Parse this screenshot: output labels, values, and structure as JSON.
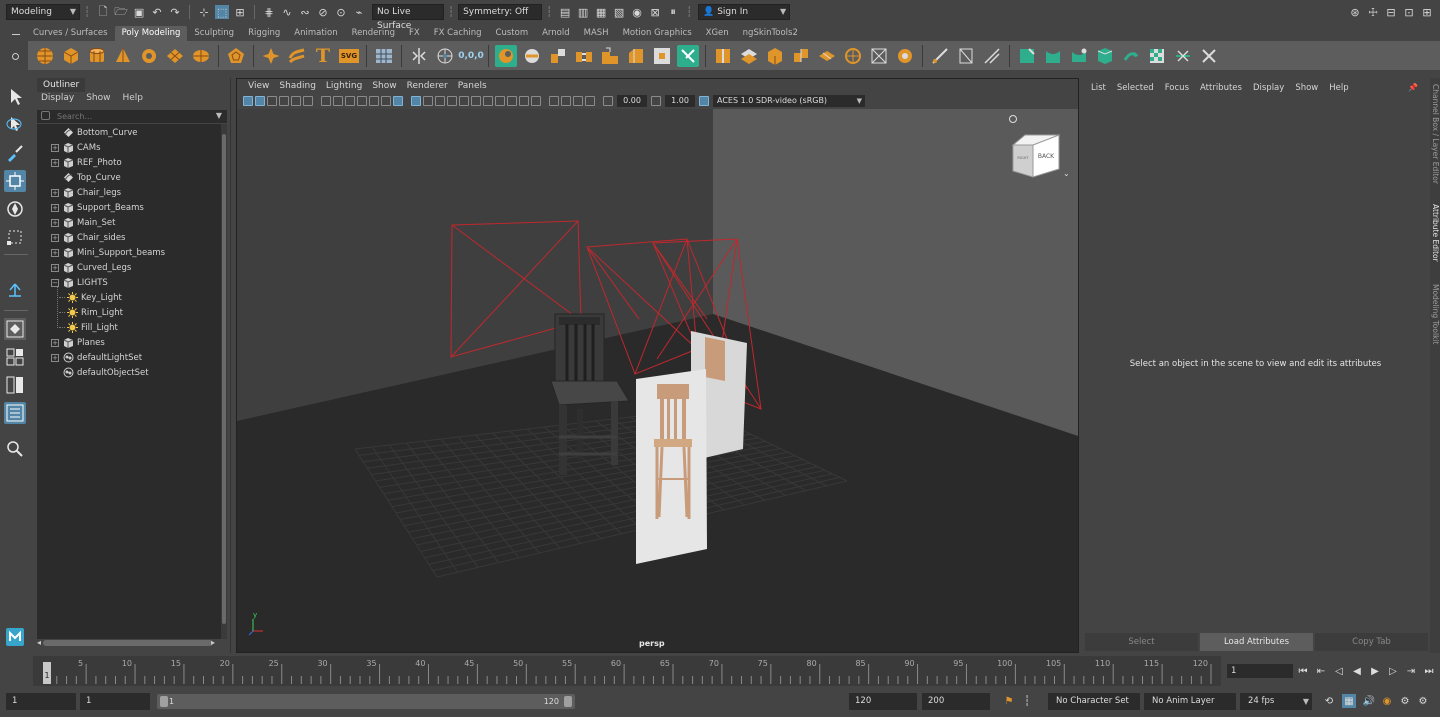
{
  "status_line": {
    "menu_set": "Modeling",
    "live_surface": "No Live Surface",
    "symmetry": "Symmetry: Off",
    "sign_in": "Sign In"
  },
  "shelf": {
    "tabs": [
      "Curves / Surfaces",
      "Poly Modeling",
      "Sculpting",
      "Rigging",
      "Animation",
      "Rendering",
      "FX",
      "FX Caching",
      "Custom",
      "Arnold",
      "MASH",
      "Motion Graphics",
      "XGen",
      "ngSkinTools2"
    ],
    "active_tab": "Poly Modeling",
    "text_tool_label": "T",
    "svg_tool_label": "SVG"
  },
  "outliner": {
    "title": "Outliner",
    "menu": [
      "Display",
      "Show",
      "Help"
    ],
    "search_placeholder": "Search...",
    "items": [
      {
        "label": "Bottom_Curve",
        "icon": "curve-icon",
        "expandable": false,
        "depth": 0
      },
      {
        "label": "CAMs",
        "icon": "group-icon",
        "expandable": true,
        "depth": 0
      },
      {
        "label": "REF_Photo",
        "icon": "group-icon",
        "expandable": true,
        "depth": 0
      },
      {
        "label": "Top_Curve",
        "icon": "curve-icon",
        "expandable": false,
        "depth": 0
      },
      {
        "label": "Chair_legs",
        "icon": "group-icon",
        "expandable": true,
        "depth": 0
      },
      {
        "label": "Support_Beams",
        "icon": "group-icon",
        "expandable": true,
        "depth": 0
      },
      {
        "label": "Main_Set",
        "icon": "group-icon",
        "expandable": true,
        "depth": 0
      },
      {
        "label": "Chair_sides",
        "icon": "group-icon",
        "expandable": true,
        "depth": 0
      },
      {
        "label": "Mini_Support_beams",
        "icon": "group-icon",
        "expandable": true,
        "depth": 0
      },
      {
        "label": "Curved_Legs",
        "icon": "group-icon",
        "expandable": true,
        "depth": 0
      },
      {
        "label": "LIGHTS",
        "icon": "group-icon",
        "expandable": true,
        "expanded": true,
        "depth": 0
      },
      {
        "label": "Key_Light",
        "icon": "light-icon",
        "expandable": false,
        "depth": 1
      },
      {
        "label": "Rim_Light",
        "icon": "light-icon",
        "expandable": false,
        "depth": 1
      },
      {
        "label": "Fill_Light",
        "icon": "light-icon",
        "expandable": false,
        "depth": 1
      },
      {
        "label": "Planes",
        "icon": "group-icon",
        "expandable": true,
        "depth": 0
      },
      {
        "label": "defaultLightSet",
        "icon": "set-icon",
        "expandable": true,
        "depth": 0
      },
      {
        "label": "defaultObjectSet",
        "icon": "set-icon",
        "expandable": false,
        "depth": 0
      }
    ]
  },
  "viewport": {
    "menu": [
      "View",
      "Shading",
      "Lighting",
      "Show",
      "Renderer",
      "Panels"
    ],
    "exposure": "0.00",
    "gamma": "1.00",
    "color_space": "ACES 1.0 SDR-video (sRGB)",
    "camera": "persp",
    "view_cube_face": "BACK",
    "view_cube_side": "RIGHT"
  },
  "attribute_editor": {
    "menu": [
      "List",
      "Selected",
      "Focus",
      "Attributes",
      "Display",
      "Show",
      "Help"
    ],
    "message": "Select an object in the scene to view and edit its attributes",
    "buttons": [
      {
        "label": "Select",
        "enabled": false
      },
      {
        "label": "Load Attributes",
        "enabled": true
      },
      {
        "label": "Copy Tab",
        "enabled": false
      }
    ],
    "side_tabs": [
      "Channel Box / Layer Editor",
      "Attribute Editor",
      "Modeling Toolkit"
    ]
  },
  "time_slider": {
    "ticks": [
      1,
      5,
      10,
      15,
      20,
      25,
      30,
      35,
      40,
      45,
      50,
      55,
      60,
      65,
      70,
      75,
      80,
      85,
      90,
      95,
      100,
      105,
      110,
      115,
      120
    ],
    "max": 120,
    "current_frame": "1"
  },
  "range_slider": {
    "start_frame": "1",
    "playback_start": "1",
    "range_start": "1",
    "range_end": "120",
    "playback_end": "120",
    "end_frame": "200",
    "character_set": "No Character Set",
    "anim_layer": "No Anim Layer",
    "fps": "24 fps"
  },
  "colors": {
    "accent": "#5285a6",
    "panel": "#444444",
    "field": "#2b2b2b",
    "shelf": "#5d5d5d",
    "camera_frustum": "#c0282d",
    "icon_orange": "#e0952a",
    "icon_green": "#2fae8d"
  }
}
